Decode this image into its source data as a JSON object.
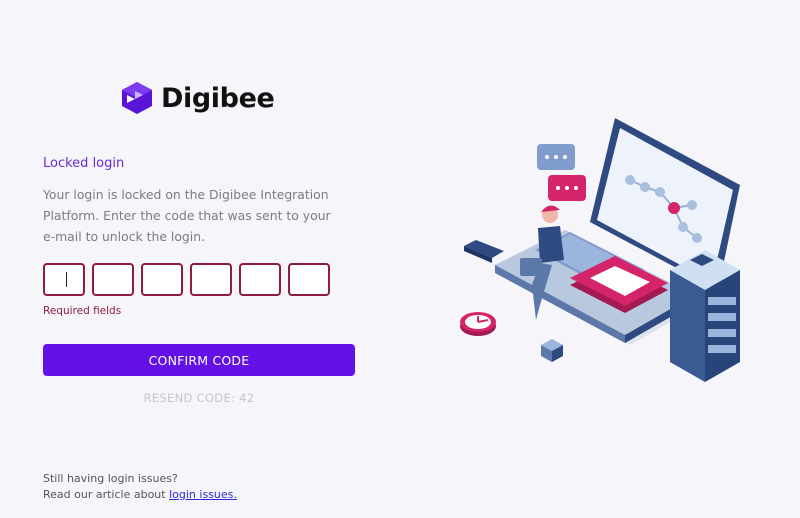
{
  "brand": {
    "name": "Digibee",
    "color": "#6411e8"
  },
  "login": {
    "title": "Locked login",
    "description": "Your login is locked on the Digibee Integration Platform. Enter the code that was sent to your e-mail to unlock the login.",
    "code_boxes": [
      "",
      "",
      "",
      "",
      "",
      ""
    ],
    "required_text": "Required fields",
    "confirm_label": "CONFIRM CODE",
    "resend_label": "RESEND CODE: 42"
  },
  "footer": {
    "line1": "Still having login issues?",
    "line2_prefix": "Read our article about",
    "link_text": "login issues."
  },
  "colors": {
    "error": "#8f1b3e",
    "title": "#6a2ccf",
    "background": "#f6f5f9"
  }
}
